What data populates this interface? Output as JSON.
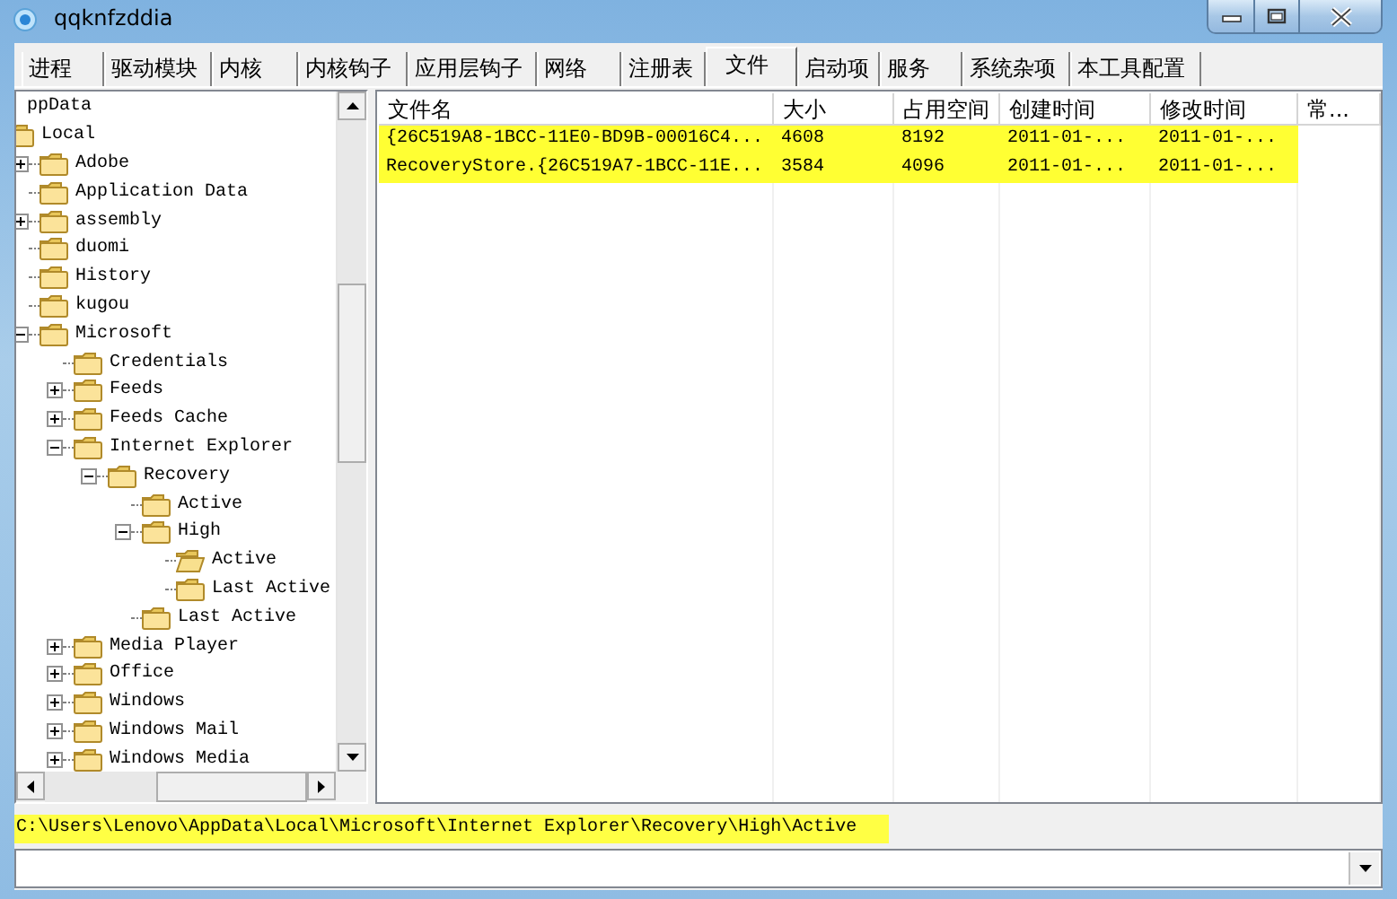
{
  "window": {
    "title": "qqknfzddia"
  },
  "tabs": [
    {
      "label": "进程",
      "selected": false
    },
    {
      "label": "驱动模块",
      "selected": false
    },
    {
      "label": "内核",
      "selected": false
    },
    {
      "label": "内核钩子",
      "selected": false
    },
    {
      "label": "应用层钩子",
      "selected": false
    },
    {
      "label": "网络",
      "selected": false
    },
    {
      "label": "注册表",
      "selected": false
    },
    {
      "label": "文件",
      "selected": true
    },
    {
      "label": "启动项",
      "selected": false
    },
    {
      "label": "服务",
      "selected": false
    },
    {
      "label": "系统杂项",
      "selected": false
    },
    {
      "label": "本工具配置",
      "selected": false
    }
  ],
  "tree": {
    "items": [
      {
        "label": "ppData",
        "children": [
          {
            "label": "Local",
            "selected": false,
            "children": [
              {
                "label": "Adobe",
                "expanded": false,
                "selected": false
              },
              {
                "label": "Application Data",
                "selected": false
              },
              {
                "label": "assembly",
                "expanded": false,
                "selected": false
              },
              {
                "label": "duomi",
                "selected": false
              },
              {
                "label": "History",
                "selected": false
              },
              {
                "label": "kugou",
                "selected": false
              },
              {
                "label": "Microsoft",
                "expanded": true,
                "selected": false,
                "children": [
                  {
                    "label": "Credentials",
                    "selected": false
                  },
                  {
                    "label": "Feeds",
                    "expanded": false,
                    "selected": false
                  },
                  {
                    "label": "Feeds Cache",
                    "expanded": false,
                    "selected": false
                  },
                  {
                    "label": "Internet Explorer",
                    "expanded": true,
                    "selected": false,
                    "children": [
                      {
                        "label": "Recovery",
                        "expanded": true,
                        "selected": false,
                        "children": [
                          {
                            "label": "Active",
                            "selected": false
                          },
                          {
                            "label": "High",
                            "expanded": true,
                            "selected": false,
                            "children": [
                              {
                                "label": "Active",
                                "selected": true
                              },
                              {
                                "label": "Last Active",
                                "selected": false
                              }
                            ]
                          },
                          {
                            "label": "Last Active",
                            "selected": false
                          }
                        ]
                      }
                    ]
                  },
                  {
                    "label": "Media Player",
                    "expanded": false,
                    "selected": false
                  },
                  {
                    "label": "Office",
                    "expanded": false,
                    "selected": false
                  },
                  {
                    "label": "Windows",
                    "expanded": false,
                    "selected": false
                  },
                  {
                    "label": "Windows Mail",
                    "expanded": false,
                    "selected": false
                  },
                  {
                    "label": "Windows Media",
                    "expanded": false,
                    "selected": false
                  }
                ]
              }
            ]
          }
        ]
      }
    ]
  },
  "table": {
    "columns": [
      "文件名",
      "大小",
      "占用空间",
      "创建时间",
      "修改时间",
      "常..."
    ],
    "rows": [
      {
        "highlighted": true,
        "cells": [
          "{26C519A8-1BCC-11E0-BD9B-00016C4...",
          "4608",
          "8192",
          "2011-01-...",
          "2011-01-..."
        ]
      },
      {
        "highlighted": true,
        "cells": [
          "RecoveryStore.{26C519A7-1BCC-11E...",
          "3584",
          "4096",
          "2011-01-...",
          "2011-01-..."
        ]
      }
    ]
  },
  "path_bar": {
    "text": "C:\\Users\\Lenovo\\AppData\\Local\\Microsoft\\Internet Explorer\\Recovery\\High\\Active",
    "highlighted": true
  }
}
